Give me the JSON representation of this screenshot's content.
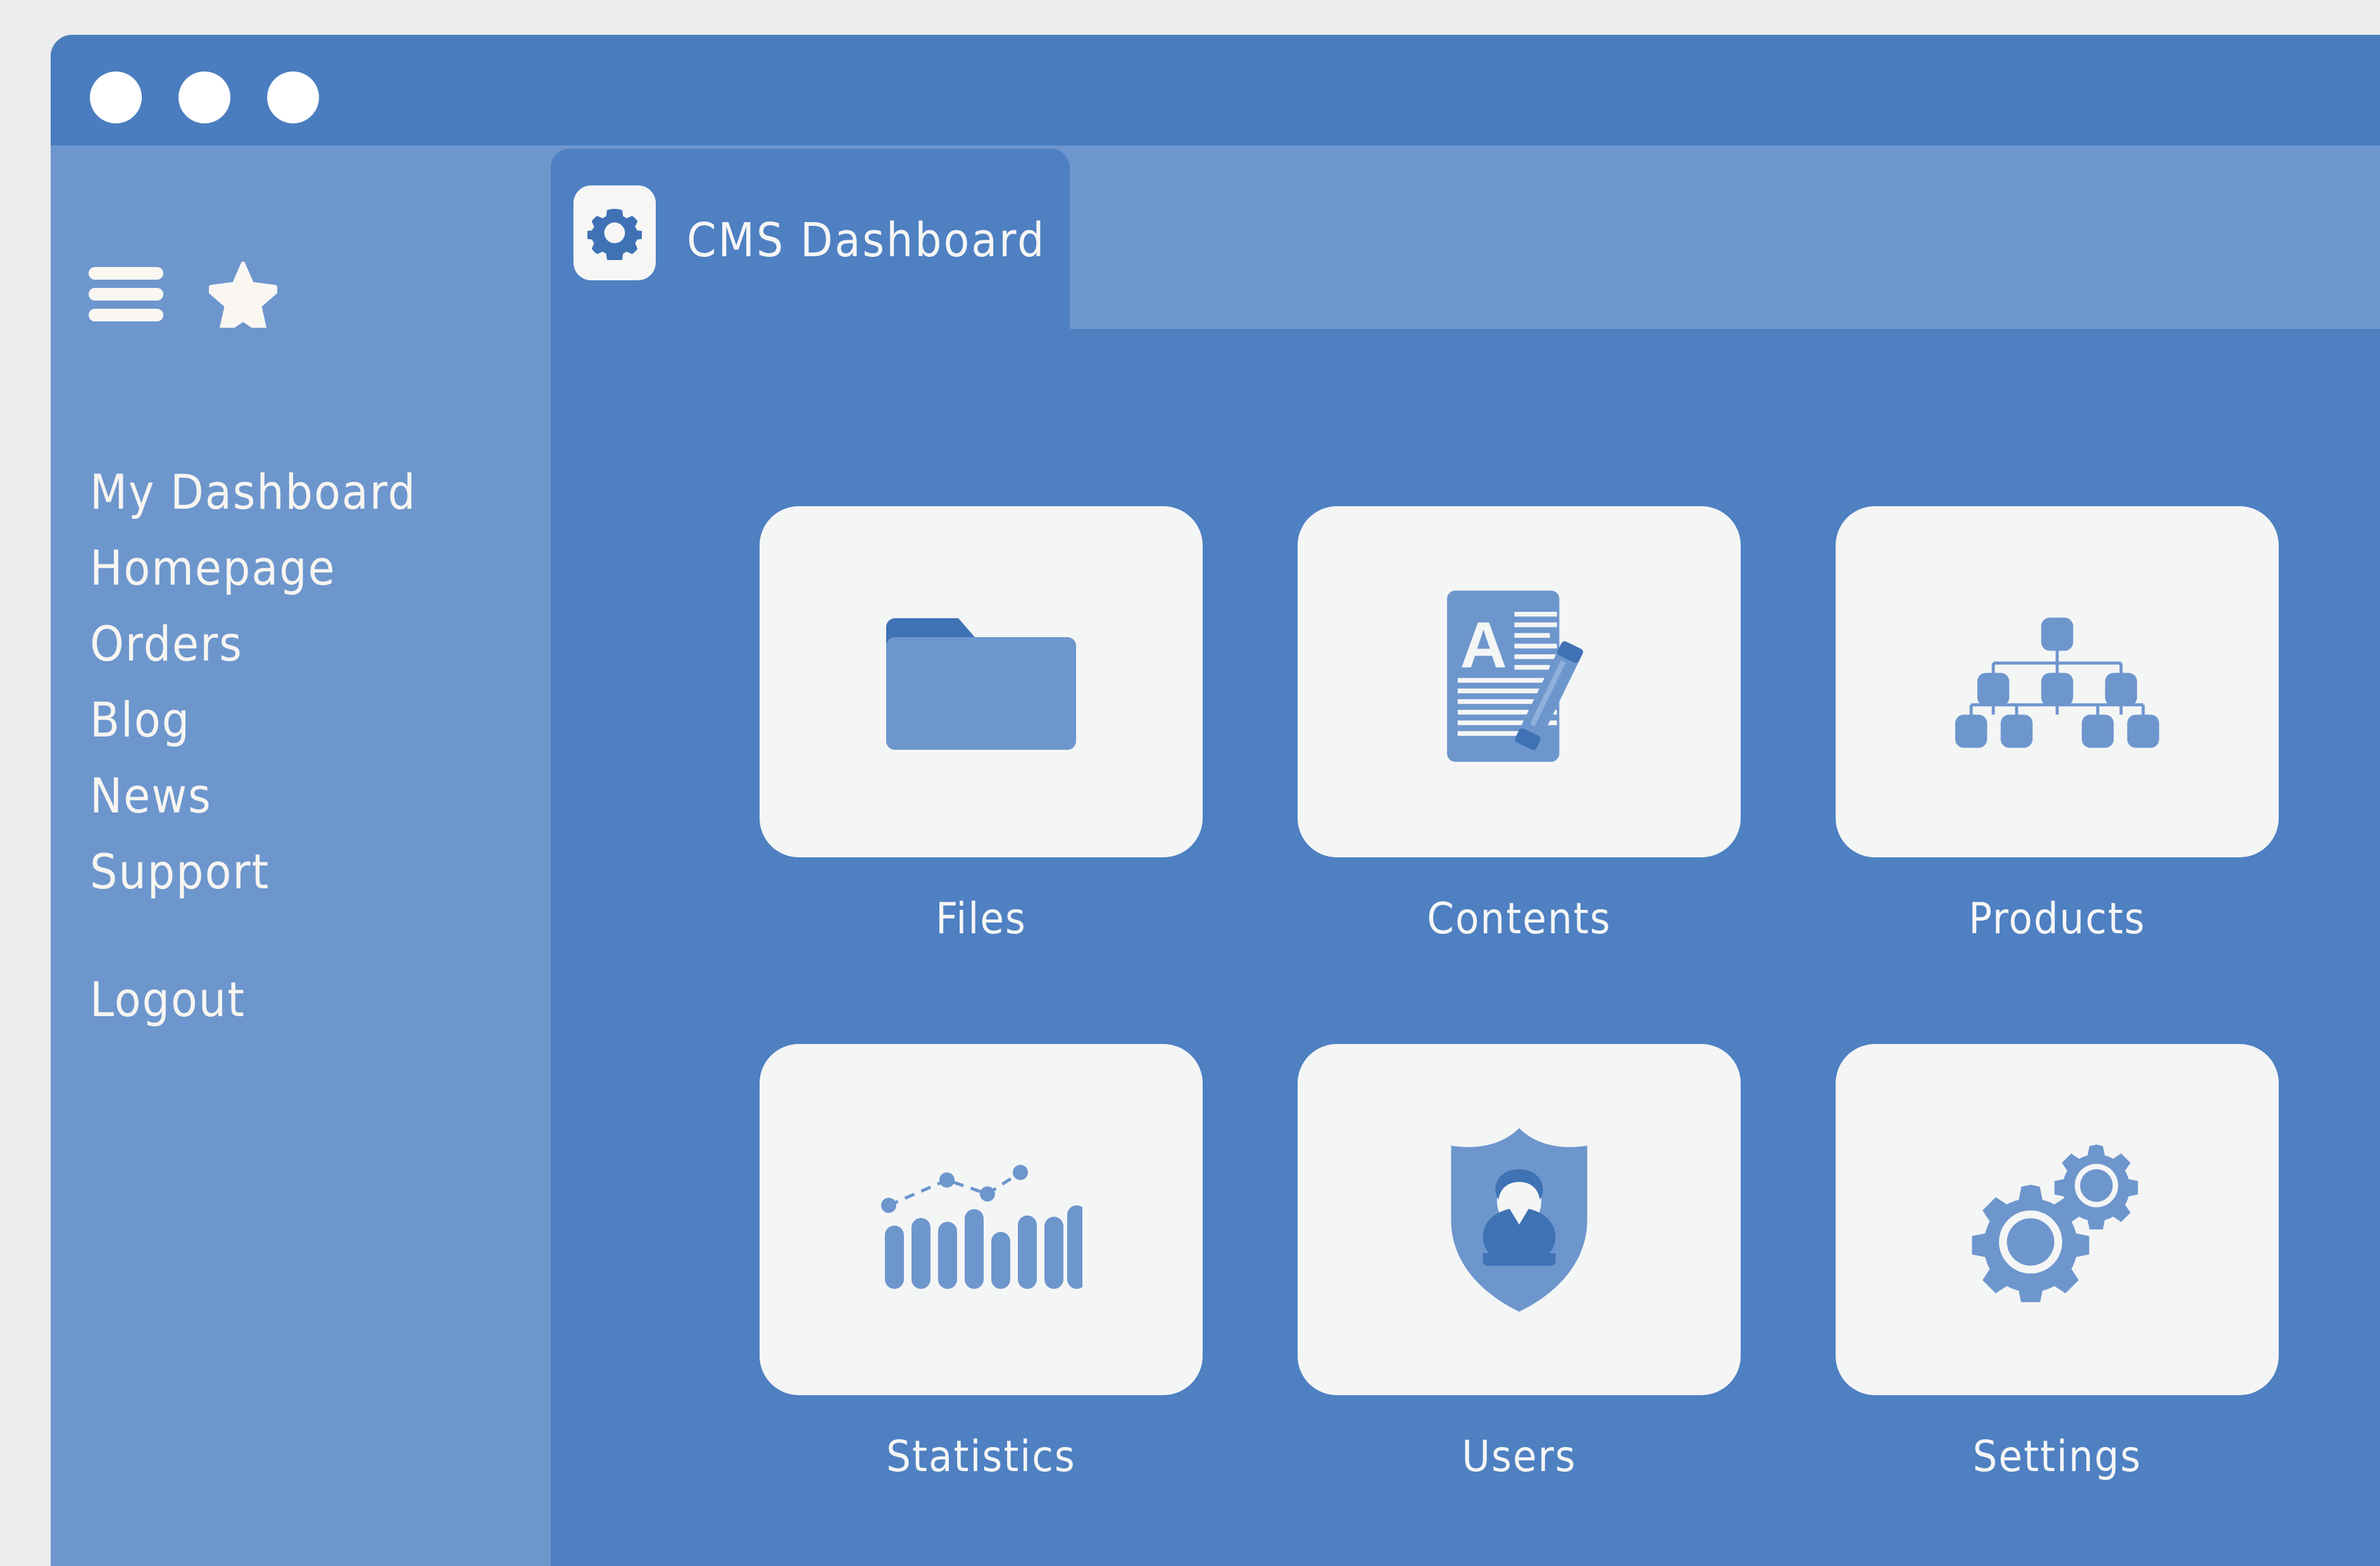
{
  "window": {
    "titlebar_dots": [
      "close-dot",
      "minimize-dot",
      "maximize-dot"
    ],
    "colors": {
      "titlebar": "#4a7dbf",
      "sidebar": "#6d96cd",
      "content": "#4e80c2",
      "card": "#f4f5f5",
      "icon_blue": "#6d96cd",
      "icon_dark_blue": "#3f72b5",
      "text_light": "#f7f5f1",
      "desktop": "#eceded"
    }
  },
  "sidebar": {
    "menu_icon": "hamburger-menu-icon",
    "favorite_icon": "star-icon",
    "items": [
      {
        "label": "My Dashboard"
      },
      {
        "label": "Homepage"
      },
      {
        "label": "Orders"
      },
      {
        "label": "Blog"
      },
      {
        "label": "News"
      },
      {
        "label": "Support"
      }
    ],
    "logout": {
      "label": "Logout"
    }
  },
  "tab": {
    "icon": "gear-icon",
    "title": "CMS Dashboard",
    "active": true
  },
  "main": {
    "cards": [
      {
        "label": "Files",
        "icon": "folder-icon"
      },
      {
        "label": "Contents",
        "icon": "document-pencil-icon"
      },
      {
        "label": "Products",
        "icon": "hierarchy-tree-icon"
      },
      {
        "label": "Statistics",
        "icon": "bar-chart-icon"
      },
      {
        "label": "Users",
        "icon": "shield-person-icon"
      },
      {
        "label": "Settings",
        "icon": "two-gears-icon"
      }
    ]
  }
}
